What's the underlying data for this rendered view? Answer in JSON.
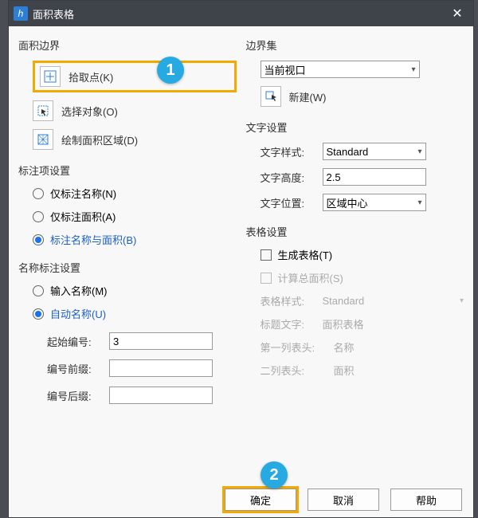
{
  "title": "面积表格",
  "left": {
    "boundary_label": "面积边界",
    "pick_point": "拾取点(K)",
    "select_obj": "选择对象(O)",
    "draw_area": "绘制面积区域(D)",
    "annot_label": "标注项设置",
    "only_name": "仅标注名称(N)",
    "only_area": "仅标注面积(A)",
    "name_and_area": "标注名称与面积(B)",
    "name_annot_label": "名称标注设置",
    "input_name": "输入名称(M)",
    "auto_name": "自动名称(U)",
    "start_no_label": "起始编号:",
    "start_no_value": "3",
    "prefix_label": "编号前缀:",
    "prefix_value": "",
    "suffix_label": "编号后缀:",
    "suffix_value": ""
  },
  "right": {
    "boundary_set_label": "边界集",
    "viewport_value": "当前视口",
    "new_btn": "新建(W)",
    "text_settings_label": "文字设置",
    "text_style_label": "文字样式:",
    "text_style_value": "Standard",
    "text_height_label": "文字高度:",
    "text_height_value": "2.5",
    "text_pos_label": "文字位置:",
    "text_pos_value": "区域中心",
    "table_settings_label": "表格设置",
    "gen_table": "生成表格(T)",
    "calc_total": "计算总面积(S)",
    "table_style_label": "表格样式:",
    "table_style_value": "Standard",
    "title_text_label": "标题文字:",
    "title_text_value": "面积表格",
    "col1_label": "第一列表头:",
    "col1_value": "名称",
    "col2_label": "二列表头:",
    "col2_value": "面积"
  },
  "footer": {
    "ok": "确定",
    "cancel": "取消",
    "help": "帮助"
  },
  "callouts": {
    "one": "1",
    "two": "2"
  }
}
